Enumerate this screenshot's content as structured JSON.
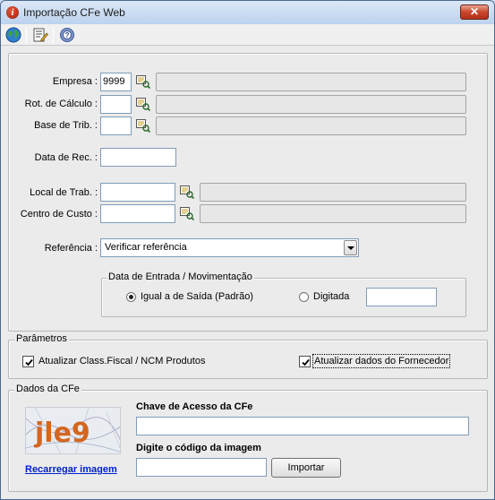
{
  "window": {
    "title": "Importação CFe Web",
    "close_label": "✕"
  },
  "toolbar": {
    "buttons": [
      "globe-icon",
      "edit-icon",
      "help-icon"
    ]
  },
  "form": {
    "empresa": {
      "label": "Empresa :",
      "value": "9999"
    },
    "rot_calculo": {
      "label": "Rot. de Cálculo :",
      "value": ""
    },
    "base_trib": {
      "label": "Base de Trib. :",
      "value": ""
    },
    "data_rec": {
      "label": "Data de Rec. :",
      "value": ""
    },
    "local_trab": {
      "label": "Local de Trab. :",
      "value": ""
    },
    "centro_custo": {
      "label": "Centro de Custo :",
      "value": ""
    },
    "referencia": {
      "label": "Referência :",
      "selected": "Verificar referência"
    },
    "data_entrada": {
      "legend": "Data de Entrada / Movimentação",
      "option_igual": "Igual a de Saída (Padrão)",
      "option_digitada": "Digitada",
      "selected": "Igual a de Saída (Padrão)",
      "digitada_value": ""
    }
  },
  "parametros": {
    "legend": "Parâmetros",
    "atualizar_class": {
      "label": "Atualizar Class.Fiscal / NCM Produtos",
      "checked": true
    },
    "atualizar_fornecedor": {
      "label": "Atualizar dados do Fornecedor",
      "checked": true
    }
  },
  "dados_cfe": {
    "legend": "Dados da CFe",
    "captcha_text": "jle9",
    "reload_link": "Recarregar imagem",
    "chave_label": "Chave de Acesso da CFe",
    "chave_value": "",
    "codigo_label": "Digite o código da imagem",
    "codigo_value": "",
    "import_button": "Importar"
  }
}
